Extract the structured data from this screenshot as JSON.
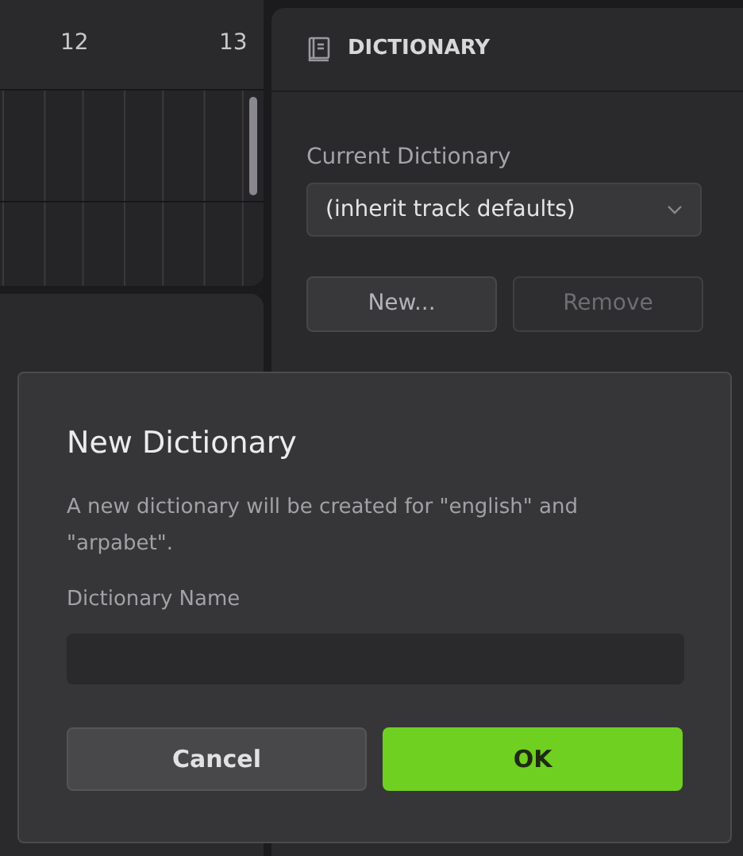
{
  "timeline": {
    "ruler_labels": [
      "12",
      "13"
    ]
  },
  "dictionary_panel": {
    "title": "DICTIONARY",
    "current_label": "Current Dictionary",
    "current_value": "(inherit track defaults)",
    "buttons": [
      {
        "label": "New...",
        "disabled": false
      },
      {
        "label": "Remove",
        "disabled": true
      }
    ]
  },
  "dialog": {
    "title": "New Dictionary",
    "message": "A new dictionary will be created for \"english\" and \"arpabet\".",
    "field_label": "Dictionary Name",
    "buttons": [
      {
        "label": "Cancel",
        "kind": "secondary"
      },
      {
        "label": "OK",
        "kind": "primary"
      }
    ]
  }
}
